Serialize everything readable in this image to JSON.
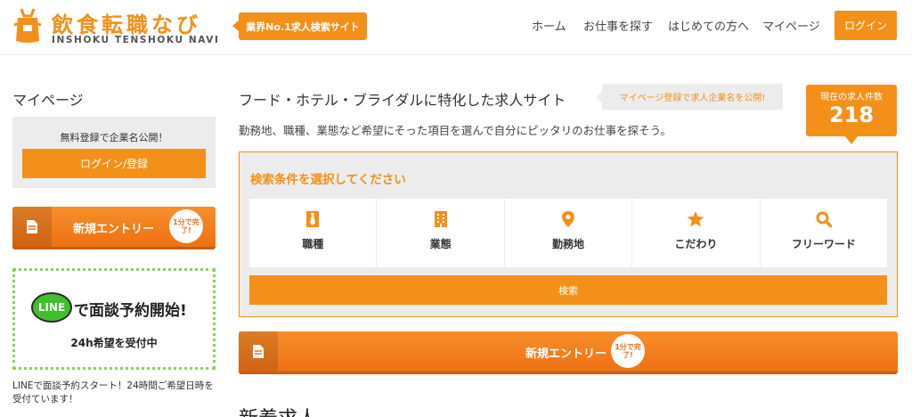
{
  "header": {
    "logo_title": "飲食転職なび",
    "logo_sub": "INSHOKU TENSHOKU NAVI",
    "tagline": "業界No.1求人検索サイト",
    "nav": [
      "ホーム",
      "お仕事を探す",
      "はじめての方へ",
      "マイページ"
    ],
    "login": "ログイン"
  },
  "sidebar": {
    "title": "マイページ",
    "box_text": "無料登録で企業名公開！",
    "login_register": "ログイン/登録",
    "entry_label": "新規エントリー",
    "entry_badge": "1分で完了!",
    "line_logo": "LINE",
    "line_head": "で面談予約開始!",
    "line_sub": "24h希望を受付中",
    "caption": "LINEで面談予約スタート！24時間ご希望日時を受付ています！"
  },
  "main": {
    "title": "フード・ホテル・ブライダルに特化した求人サイト",
    "notice": "マイページ登録で求人企業名を公開!",
    "count_label": "現在の求人件数",
    "count_value": "218",
    "desc": "勤務地、職種、業態など希望にそった項目を選んで自分にピッタリのお仕事を探そう。",
    "search_heading": "検索条件を選択してください",
    "categories": [
      {
        "label": "職種",
        "icon": "tie-icon"
      },
      {
        "label": "業態",
        "icon": "building-icon"
      },
      {
        "label": "勤務地",
        "icon": "map-pin-icon"
      },
      {
        "label": "こだわり",
        "icon": "star-icon"
      },
      {
        "label": "フリーワード",
        "icon": "search-icon"
      }
    ],
    "search_button": "検索",
    "entry_label": "新規エントリー",
    "entry_badge": "1分で完了!",
    "section_heading": "新着求人"
  },
  "colors": {
    "accent": "#f39019",
    "entry_gradient_top": "#f78f2a",
    "entry_gradient_bottom": "#ef7014",
    "line_green": "#3fbf2c",
    "panel_gray": "#ececec"
  }
}
